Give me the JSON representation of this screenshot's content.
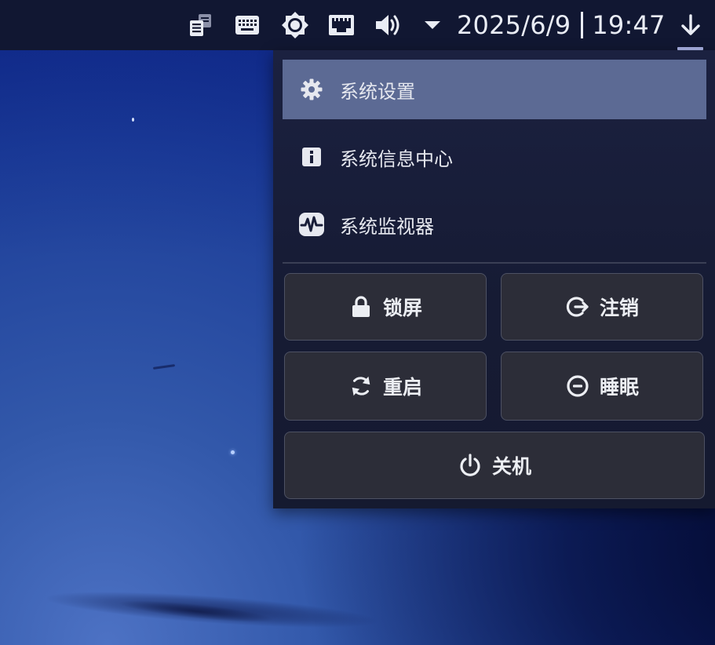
{
  "panel": {
    "tray": [
      {
        "name": "notes-icon"
      },
      {
        "name": "keyboard-icon"
      },
      {
        "name": "brightness-icon"
      },
      {
        "name": "network-icon"
      },
      {
        "name": "volume-icon"
      },
      {
        "name": "expand-triangle-icon"
      }
    ],
    "date": "2025/6/9",
    "time": "19:47",
    "download_icon": "arrow-down-icon"
  },
  "menu": {
    "items": [
      {
        "label": "系统设置",
        "icon": "gear-icon",
        "active": true
      },
      {
        "label": "系统信息中心",
        "icon": "info-icon",
        "active": false
      },
      {
        "label": "系统监视器",
        "icon": "system-monitor-icon",
        "active": false
      }
    ],
    "actions": {
      "lock": {
        "label": "锁屏",
        "icon": "lock-icon"
      },
      "logout": {
        "label": "注销",
        "icon": "logout-icon"
      },
      "restart": {
        "label": "重启",
        "icon": "restart-icon"
      },
      "sleep": {
        "label": "睡眠",
        "icon": "sleep-icon"
      },
      "shutdown": {
        "label": "关机",
        "icon": "power-icon"
      }
    }
  },
  "colors": {
    "panel_bg": "#111732",
    "menu_bg": "#1b2140",
    "active_item": "#5c6a94",
    "button_bg": "#2c2d38",
    "button_border": "#4d5163",
    "text": "#e6e8ef"
  }
}
